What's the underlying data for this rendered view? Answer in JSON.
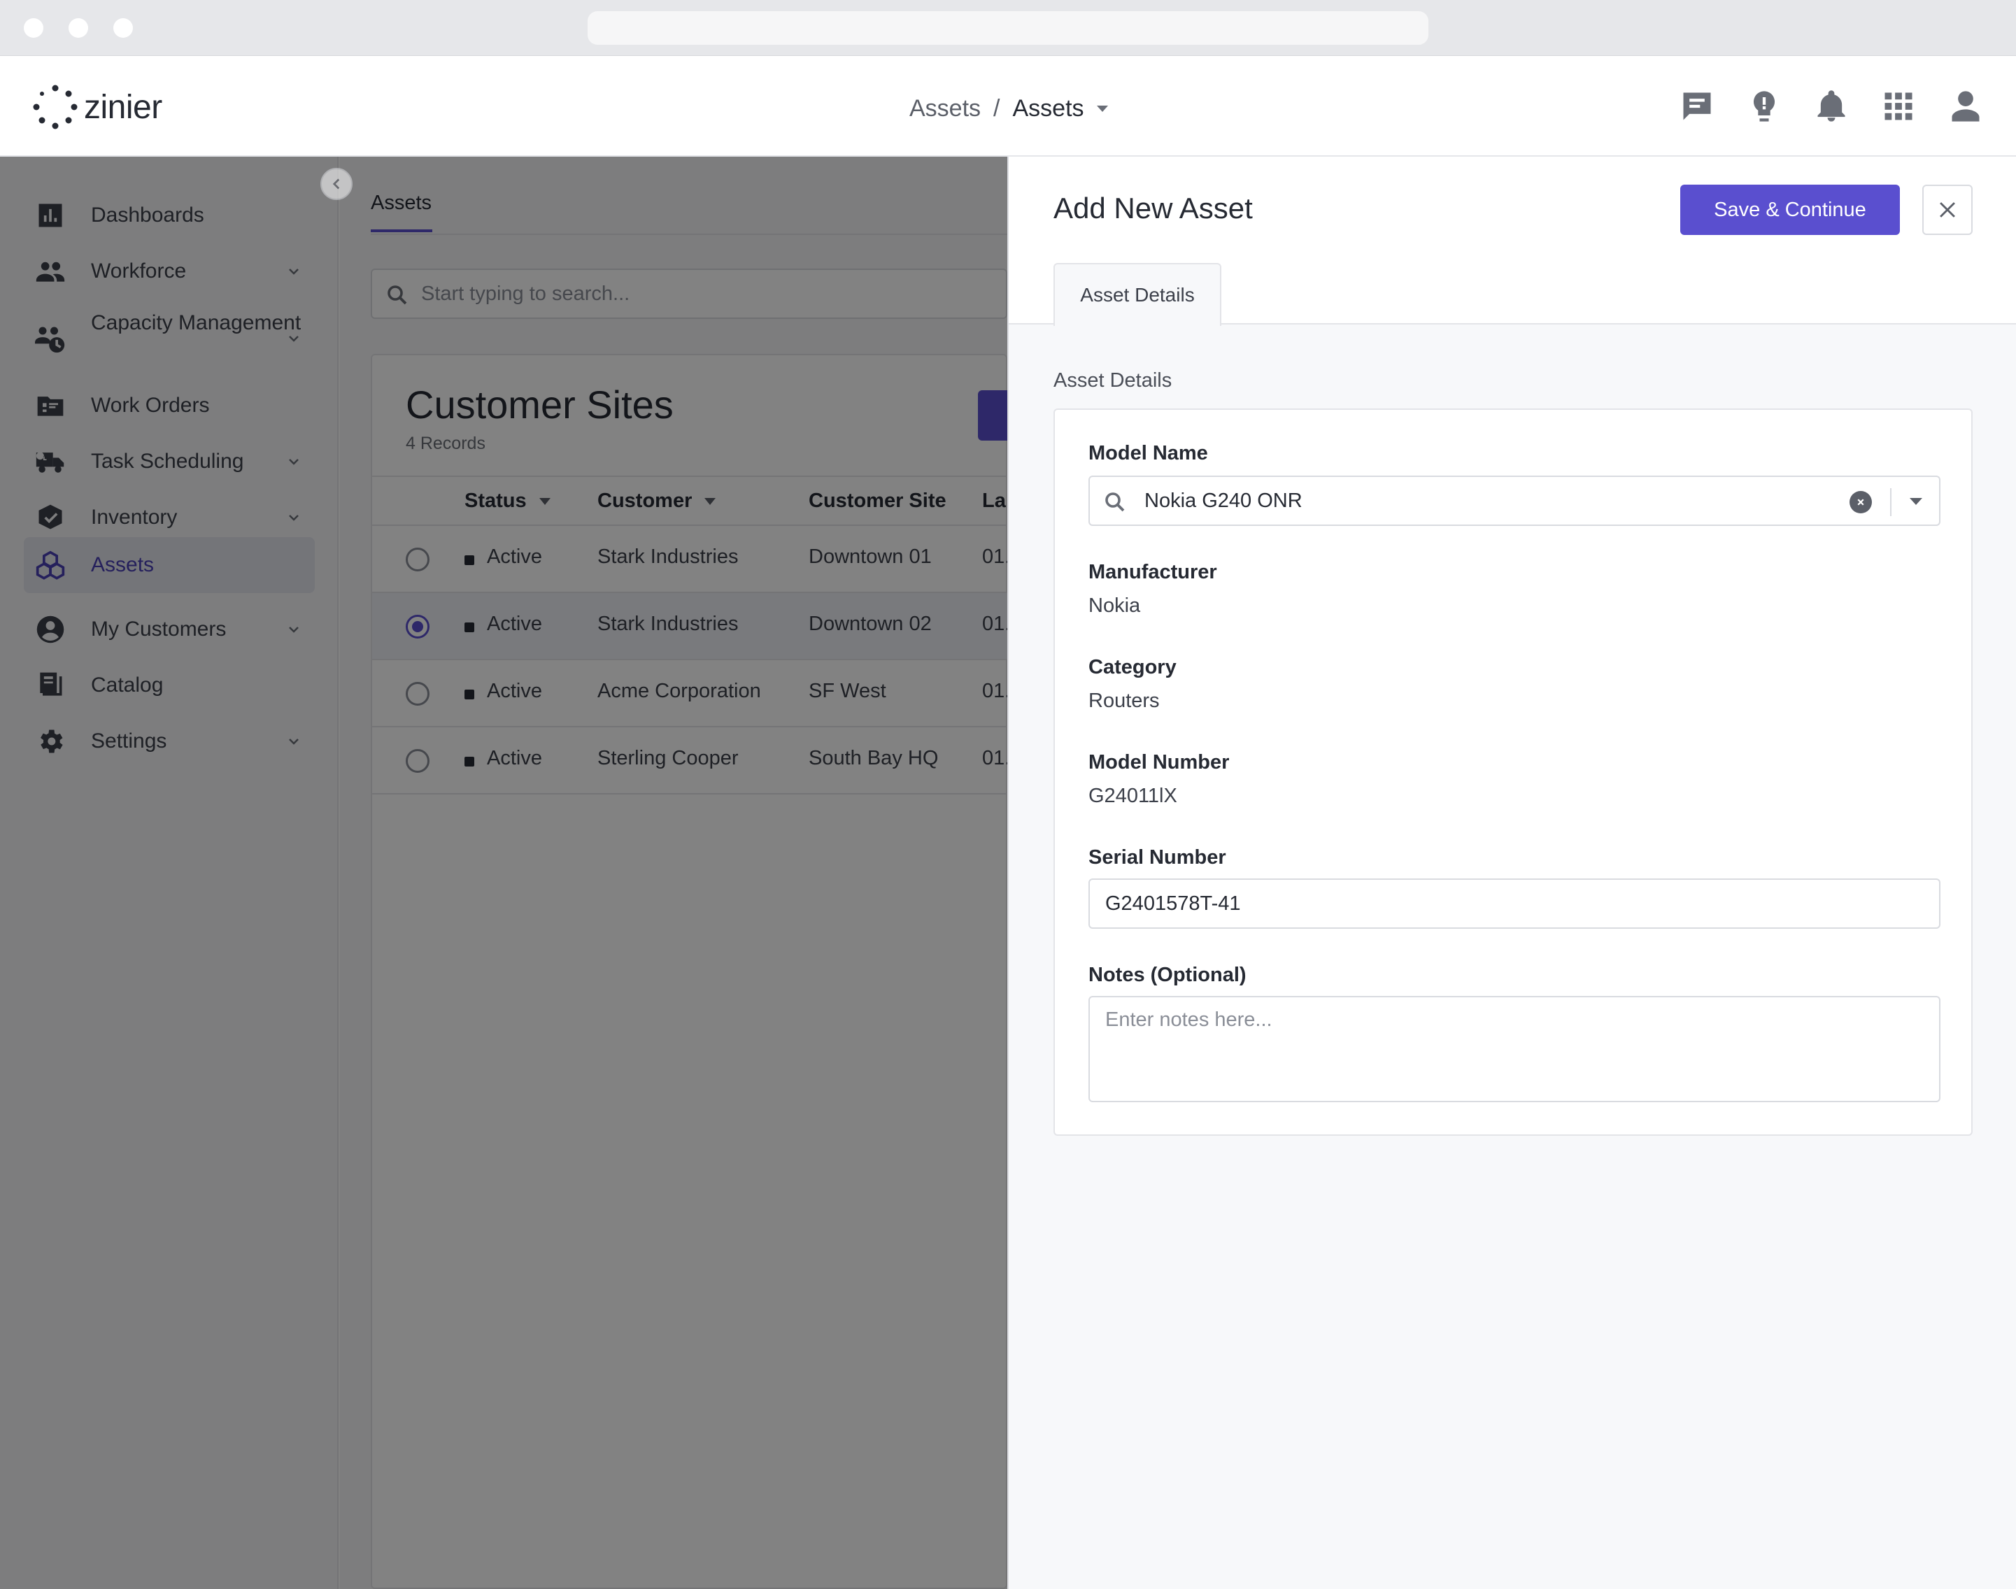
{
  "app": {
    "logo_text": "zinier",
    "breadcrumb": {
      "first": "Assets",
      "separator": "/",
      "current": "Assets"
    },
    "top_icons": [
      "chat-icon",
      "lightbulb-icon",
      "bell-icon",
      "apps-grid-icon",
      "user-icon"
    ]
  },
  "sidebar": {
    "items": [
      {
        "label": "Dashboards",
        "icon": "bar-chart-icon",
        "has_children": false
      },
      {
        "label": "Workforce",
        "icon": "people-icon",
        "has_children": true
      },
      {
        "label": "Capacity Management",
        "icon": "capacity-icon",
        "has_children": true
      },
      {
        "label": "Work Orders",
        "icon": "work-orders-icon",
        "has_children": false
      },
      {
        "label": "Task Scheduling",
        "icon": "truck-icon",
        "has_children": true
      },
      {
        "label": "Inventory",
        "icon": "inventory-icon",
        "has_children": true
      },
      {
        "label": "Assets",
        "icon": "assets-icon",
        "has_children": false,
        "active": true
      },
      {
        "label": "My Customers",
        "icon": "customer-icon",
        "has_children": true
      },
      {
        "label": "Catalog",
        "icon": "catalog-icon",
        "has_children": false
      },
      {
        "label": "Settings",
        "icon": "gear-icon",
        "has_children": true
      }
    ]
  },
  "main": {
    "tab_label": "Assets",
    "search_placeholder": "Start typing to search...",
    "card": {
      "title": "Customer Sites",
      "record_count": "4 Records",
      "columns": [
        "Status",
        "Customer",
        "Customer Site",
        "La"
      ],
      "rows": [
        {
          "status": "Active",
          "customer": "Stark Industries",
          "site": "Downtown 01",
          "last": "01.",
          "selected": false
        },
        {
          "status": "Active",
          "customer": "Stark Industries",
          "site": "Downtown 02",
          "last": "01.",
          "selected": true
        },
        {
          "status": "Active",
          "customer": "Acme Corporation",
          "site": "SF West",
          "last": "01.",
          "selected": false
        },
        {
          "status": "Active",
          "customer": "Sterling Cooper",
          "site": "South Bay HQ",
          "last": "01.",
          "selected": false
        }
      ]
    }
  },
  "panel": {
    "title": "Add New Asset",
    "save_label": "Save & Continue",
    "tab_label": "Asset Details",
    "section_label": "Asset Details",
    "fields": {
      "model_name": {
        "label": "Model Name",
        "value": "Nokia G240 ONR"
      },
      "manufacturer": {
        "label": "Manufacturer",
        "value": "Nokia"
      },
      "category": {
        "label": "Category",
        "value": "Routers"
      },
      "model_number": {
        "label": "Model Number",
        "value": "G24011lX"
      },
      "serial_number": {
        "label": "Serial Number",
        "value": "G2401578T-41"
      },
      "notes": {
        "label": "Notes (Optional)",
        "placeholder": "Enter notes here..."
      }
    }
  },
  "colors": {
    "accent": "#5a4fcf",
    "overlay": "rgba(0,0,0,0.49)"
  }
}
